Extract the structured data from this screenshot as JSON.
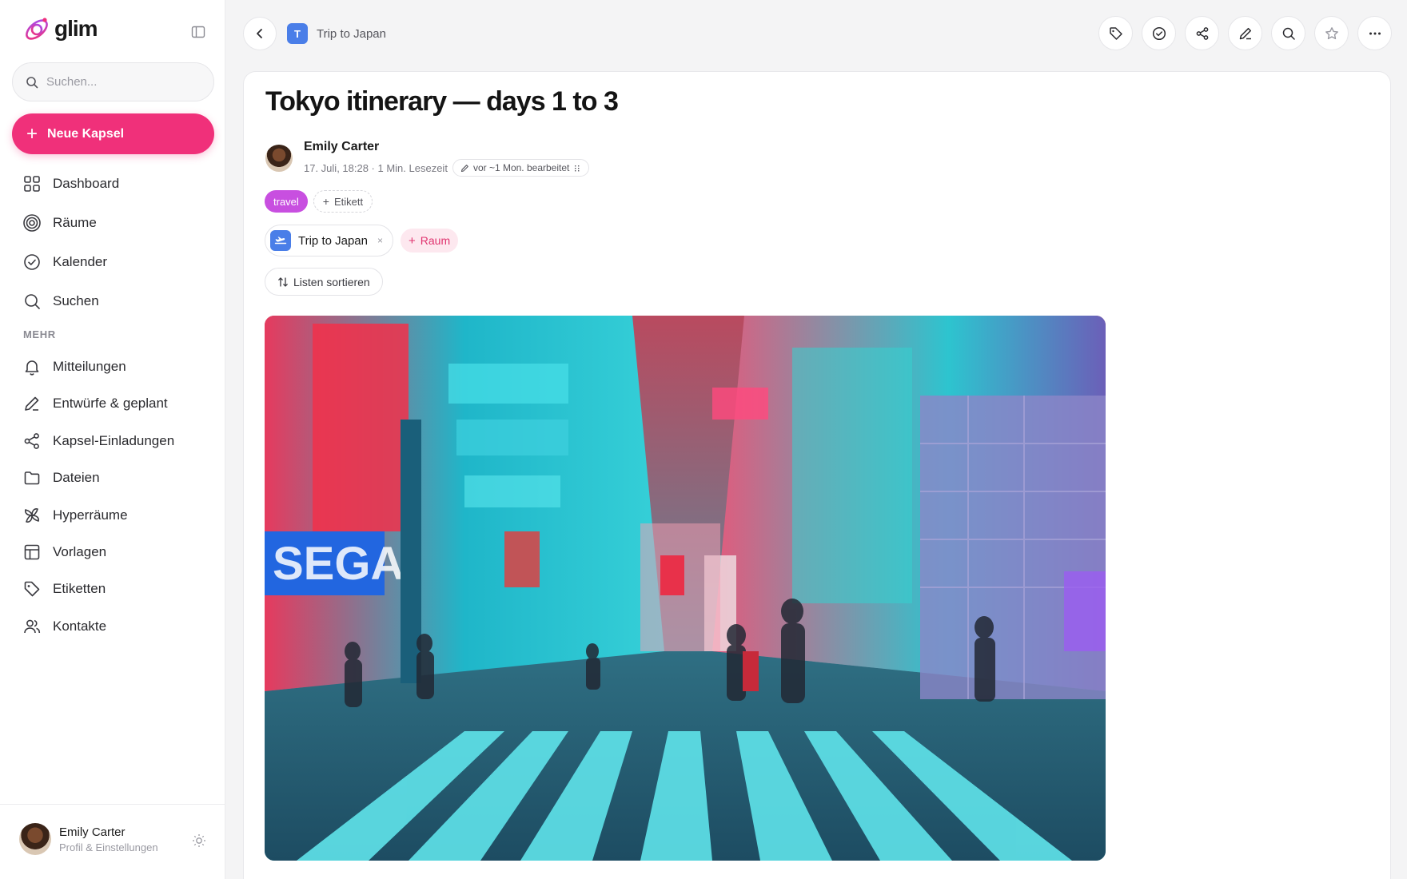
{
  "app": {
    "name": "glim"
  },
  "sidebar": {
    "search_placeholder": "Suchen...",
    "new_button_label": "Neue Kapsel",
    "primary_items": [
      {
        "label": "Dashboard",
        "icon": "grid-icon"
      },
      {
        "label": "Räume",
        "icon": "target-icon"
      },
      {
        "label": "Kalender",
        "icon": "check-circle-icon"
      },
      {
        "label": "Suchen",
        "icon": "search-icon"
      }
    ],
    "section_label": "MEHR",
    "more_items": [
      {
        "label": "Mitteilungen",
        "icon": "bell-icon"
      },
      {
        "label": "Entwürfe & geplant",
        "icon": "pencil-icon"
      },
      {
        "label": "Kapsel-Einladungen",
        "icon": "share-icon"
      },
      {
        "label": "Dateien",
        "icon": "folder-icon"
      },
      {
        "label": "Hyperräume",
        "icon": "pinwheel-icon"
      },
      {
        "label": "Vorlagen",
        "icon": "template-icon"
      },
      {
        "label": "Etiketten",
        "icon": "tag-icon"
      },
      {
        "label": "Kontakte",
        "icon": "users-icon"
      }
    ],
    "profile": {
      "name": "Emily Carter",
      "subtitle": "Profil & Einstellungen"
    }
  },
  "topbar": {
    "breadcrumb_badge": "T",
    "breadcrumb_label": "Trip to Japan",
    "tools": [
      "tag-icon",
      "check-circle-icon",
      "share-icon",
      "pencil-icon",
      "search-icon",
      "star-icon",
      "more-icon"
    ]
  },
  "capsule": {
    "title": "Tokyo itinerary — days 1 to 3",
    "author": "Emily Carter",
    "meta": "17. Juli, 18:28 · 1 Min. Lesezeit",
    "edited": "vor ~1 Mon. bearbeitet",
    "tags": [
      "travel"
    ],
    "add_tag_label": "Etikett",
    "space_label": "Trip to Japan",
    "add_space_label": "Raum",
    "sort_label": "Listen sortieren"
  },
  "colors": {
    "accent": "#f0307a",
    "tag_travel": "#c84fe0",
    "space_blue": "#4a7ee8"
  }
}
